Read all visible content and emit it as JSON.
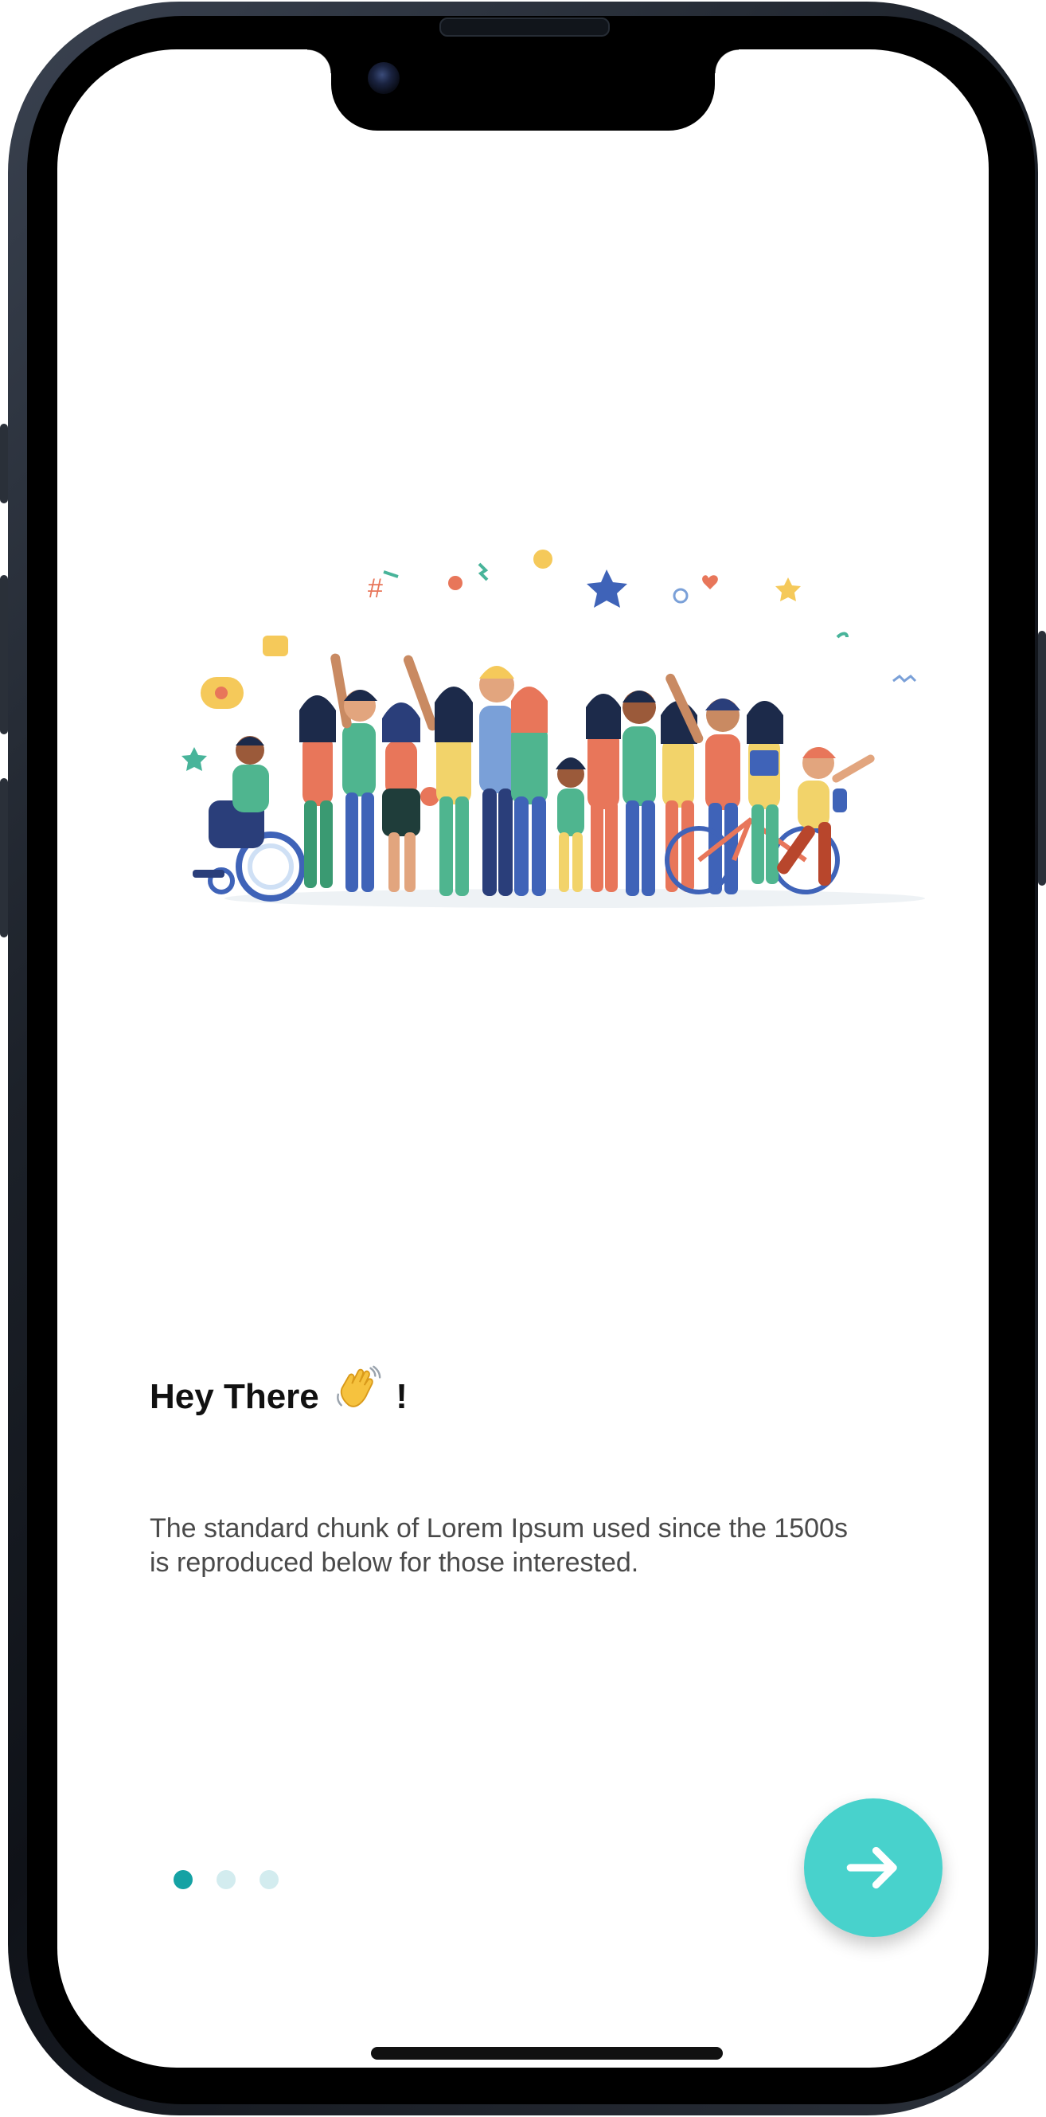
{
  "onboarding": {
    "title": "Hey There",
    "title_emoji": "waving-hand-icon",
    "title_suffix": "!",
    "description": "The standard chunk of Lorem Ipsum used since the 1500s is reproduced below for those interested.",
    "pagination": {
      "total": 3,
      "active_index": 0
    },
    "next_icon": "arrow-right-icon"
  },
  "colors": {
    "accent": "#48d2cc",
    "dot_active": "#15a2a4",
    "dot_inactive": "#d3ecef"
  }
}
